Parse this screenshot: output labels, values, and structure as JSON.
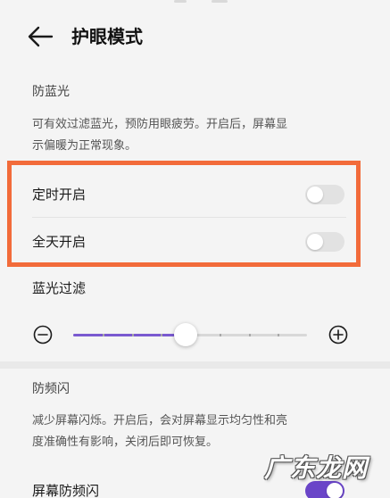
{
  "header": {
    "title": "护眼模式",
    "back_icon": "arrow-left-icon"
  },
  "blue_light": {
    "section_title": "防蓝光",
    "description_line1": "可有效过滤蓝光，预防用眼疲劳。开启后，屏幕显",
    "description_line2": "示偏暖为正常现象。",
    "scheduled": {
      "label": "定时开启",
      "on": false
    },
    "all_day": {
      "label": "全天开启",
      "on": false
    },
    "filter": {
      "label": "蓝光过滤",
      "level": 0.48,
      "ticks": 8
    }
  },
  "flicker": {
    "section_title": "防频闪",
    "description_line1": "减少屏幕闪烁。开启后，会对屏幕显示均匀性和亮",
    "description_line2": "度准确性有影响，关闭后即可恢复。",
    "screen_antiflicker": {
      "label": "屏幕防频闪",
      "on": true
    }
  },
  "watermark": "广东龙网",
  "colors": {
    "accent": "#6a45c8",
    "highlight": "#f26b3a",
    "toggle_off": "#e2e2e2"
  }
}
